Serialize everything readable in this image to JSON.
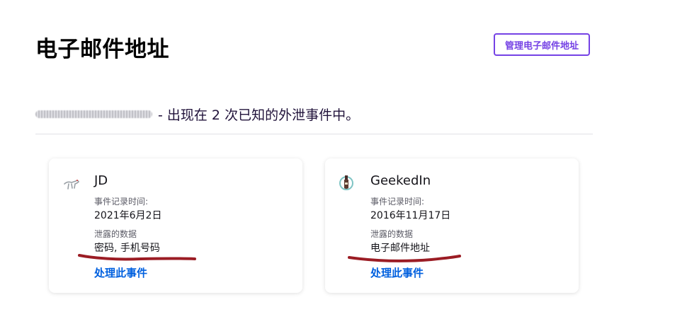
{
  "header": {
    "title": "电子邮件地址",
    "manage_button": "管理电子邮件地址"
  },
  "email_summary": {
    "text": "- 出现在 2 次已知的外泄事件中。"
  },
  "breaches": [
    {
      "name": "JD",
      "date_label": "事件记录时间:",
      "date": "2021年6月2日",
      "data_label": "泄露的数据",
      "data": "密码, 手机号码",
      "action": "处理此事件",
      "logo_icon": "jd-dog-logo-icon"
    },
    {
      "name": "GeekedIn",
      "date_label": "事件记录时间:",
      "date": "2016年11月17日",
      "data_label": "泄露的数据",
      "data": "电子邮件地址",
      "action": "处理此事件",
      "logo_icon": "geekedin-bottle-logo-icon"
    }
  ],
  "colors": {
    "accent": "#7542e5",
    "link": "#0060df",
    "scribble": "#9b1c24"
  }
}
